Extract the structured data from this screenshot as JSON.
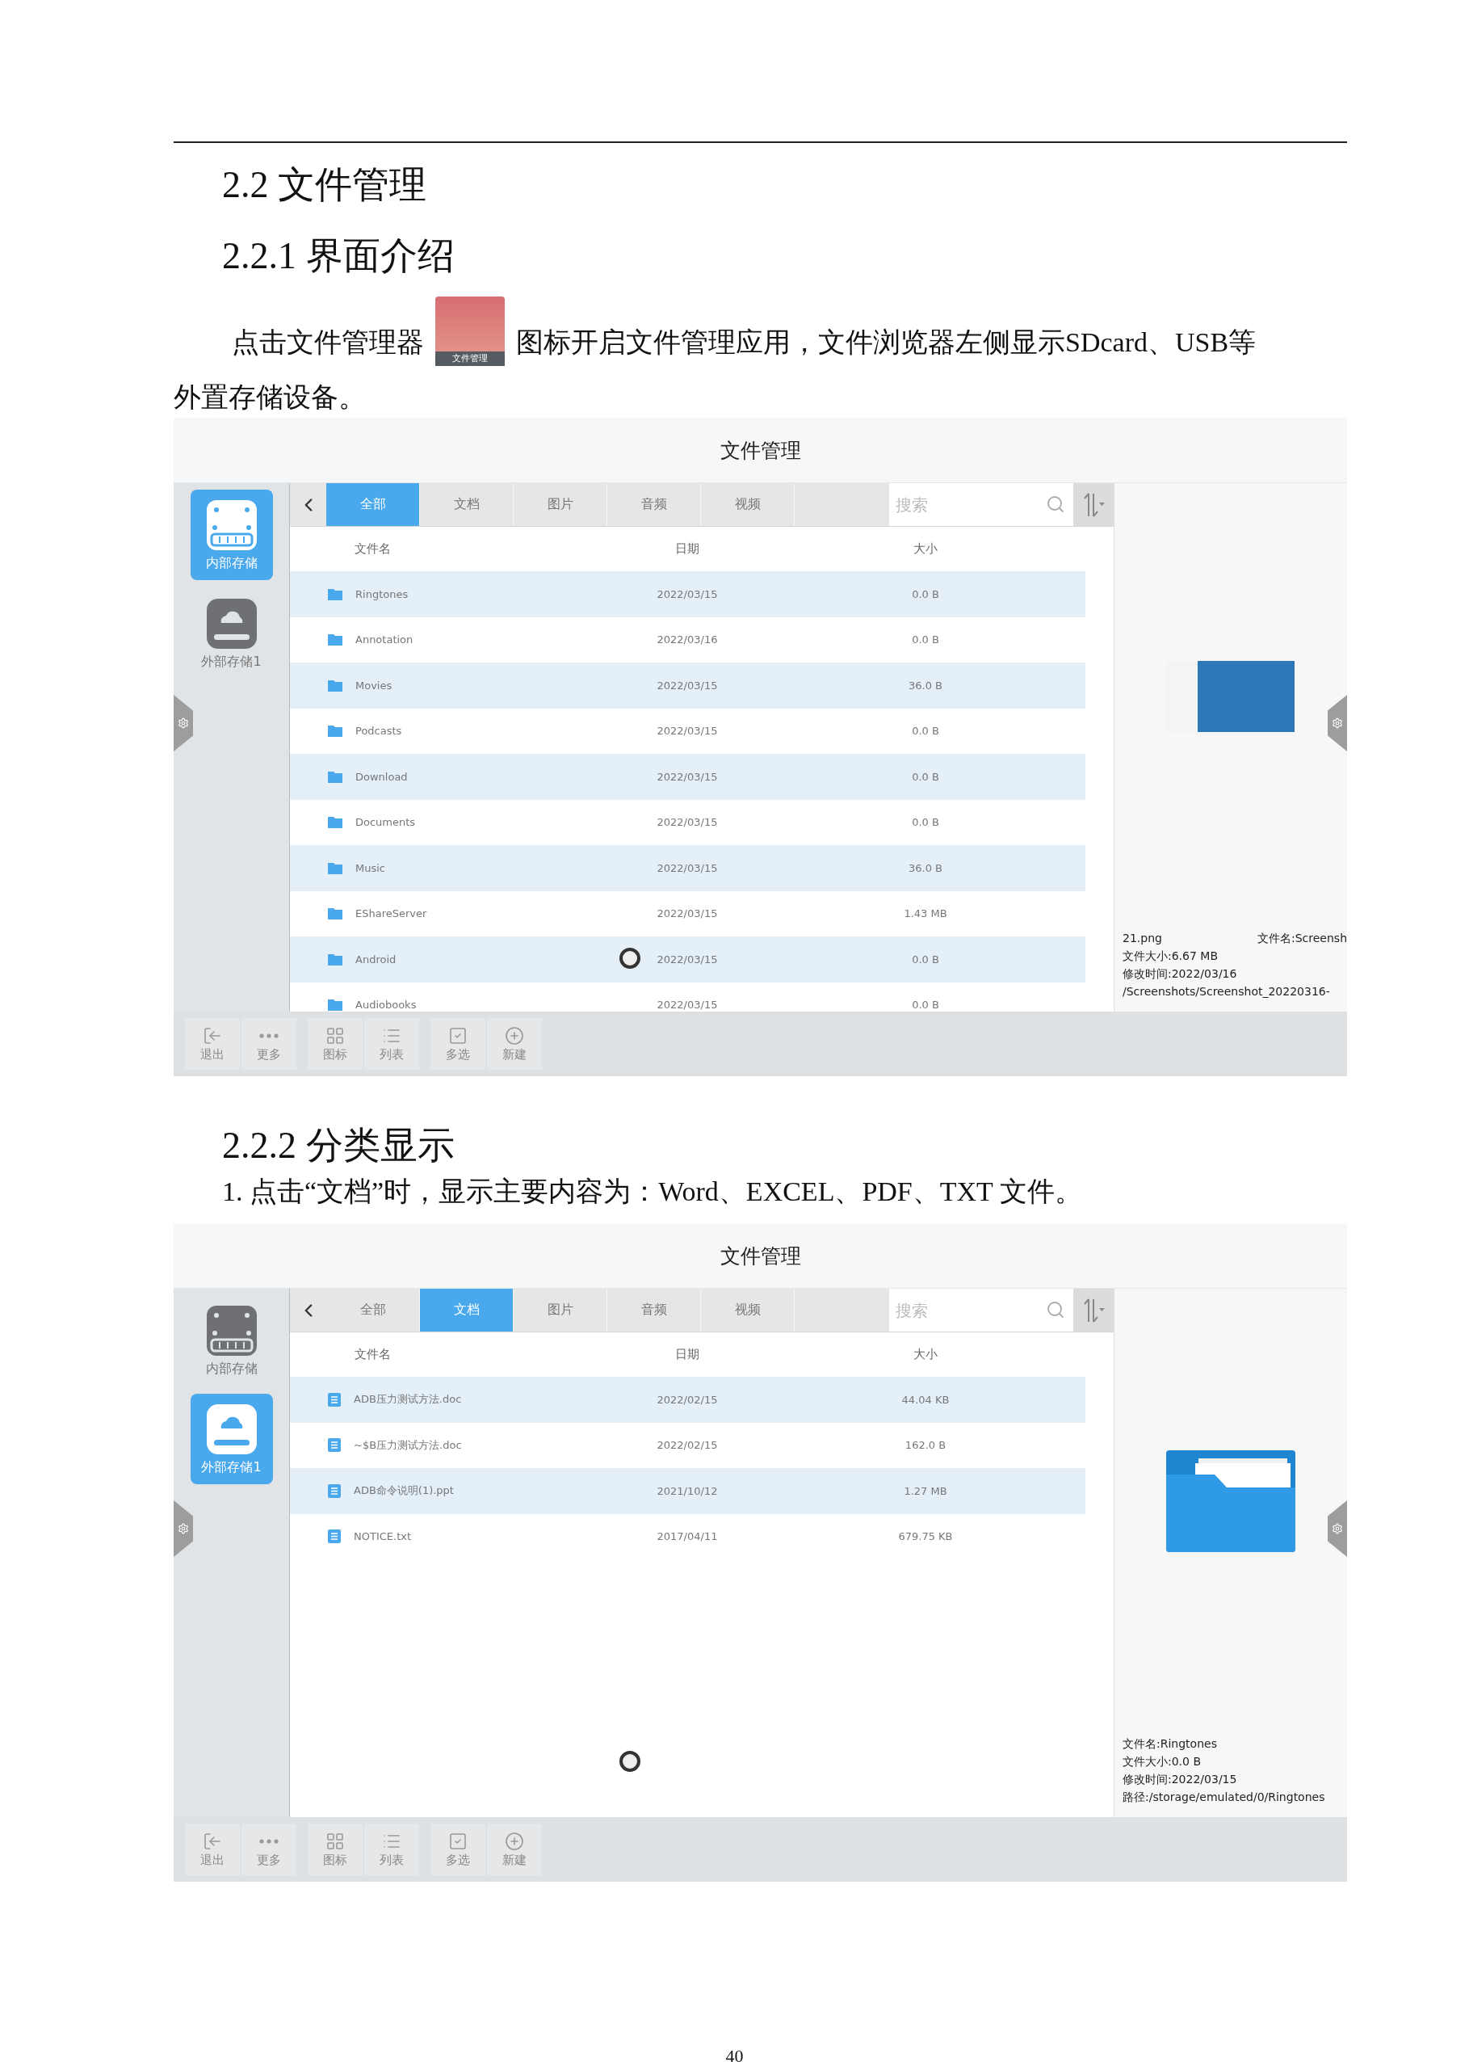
{
  "section_heading": "2.2 文件管理",
  "subsection_1": "2.2.1 界面介绍",
  "intro": {
    "before": "点击文件管理器",
    "icon_label": "文件管理",
    "after": "图标开启文件管理应用，文件浏览器左侧显示SDcard、USB等",
    "continuation": "外置存储设备。"
  },
  "screenshot_1": {
    "title": "文件管理",
    "storage": [
      {
        "label": "内部存储",
        "kind": "internal",
        "selected": true
      },
      {
        "label": "外部存储1",
        "kind": "external",
        "selected": false
      }
    ],
    "tabs": [
      {
        "label": "全部",
        "selected": true
      },
      {
        "label": "文档",
        "selected": false
      },
      {
        "label": "图片",
        "selected": false
      },
      {
        "label": "音频",
        "selected": false
      },
      {
        "label": "视频",
        "selected": false
      }
    ],
    "search": {
      "placeholder": "搜索"
    },
    "columns": [
      "文件名",
      "日期",
      "大小"
    ],
    "rows": [
      {
        "kind": "folder",
        "name": "Ringtones",
        "date": "2022/03/15",
        "size": "0.0 B"
      },
      {
        "kind": "folder",
        "name": "Annotation",
        "date": "2022/03/16",
        "size": "0.0 B"
      },
      {
        "kind": "folder",
        "name": "Movies",
        "date": "2022/03/15",
        "size": "36.0 B"
      },
      {
        "kind": "folder",
        "name": "Podcasts",
        "date": "2022/03/15",
        "size": "0.0 B"
      },
      {
        "kind": "folder",
        "name": "Download",
        "date": "2022/03/15",
        "size": "0.0 B"
      },
      {
        "kind": "folder",
        "name": "Documents",
        "date": "2022/03/15",
        "size": "0.0 B"
      },
      {
        "kind": "folder",
        "name": "Music",
        "date": "2022/03/15",
        "size": "36.0 B"
      },
      {
        "kind": "folder",
        "name": "EShareServer",
        "date": "2022/03/15",
        "size": "1.43 MB"
      },
      {
        "kind": "folder",
        "name": "Android",
        "date": "2022/03/15",
        "size": "0.0 B"
      },
      {
        "kind": "folder",
        "name": "Audiobooks",
        "date": "2022/03/15",
        "size": "0.0 B"
      }
    ],
    "preview": {
      "kind": "image",
      "lines": [
        [
          "21.png",
          "文件名:Screensh"
        ],
        [
          "文件大小:6.67 MB"
        ],
        [
          "修改时间:2022/03/16"
        ],
        [
          "/Screenshots/Screenshot_20220316-"
        ]
      ]
    },
    "toolbar": [
      [
        {
          "kind": "exit",
          "label": "退出"
        },
        {
          "kind": "more",
          "label": "更多"
        }
      ],
      [
        {
          "kind": "grid",
          "label": "图标"
        },
        {
          "kind": "list",
          "label": "列表"
        }
      ],
      [
        {
          "kind": "multi",
          "label": "多选"
        },
        {
          "kind": "new",
          "label": "新建"
        }
      ]
    ]
  },
  "subsection_2": "2.2.2  分类显示",
  "note": "1. 点击“文档”时，显示主要内容为：Word、EXCEL、PDF、TXT 文件。",
  "screenshot_2": {
    "title": "文件管理",
    "storage": [
      {
        "label": "内部存储",
        "kind": "internal",
        "selected": false
      },
      {
        "label": "外部存储1",
        "kind": "external",
        "selected": true
      }
    ],
    "tabs": [
      {
        "label": "全部",
        "selected": false
      },
      {
        "label": "文档",
        "selected": true
      },
      {
        "label": "图片",
        "selected": false
      },
      {
        "label": "音频",
        "selected": false
      },
      {
        "label": "视频",
        "selected": false
      }
    ],
    "search": {
      "placeholder": "搜索"
    },
    "columns": [
      "文件名",
      "日期",
      "大小"
    ],
    "rows": [
      {
        "kind": "doc",
        "name": "ADB压力测试方法.doc",
        "date": "2022/02/15",
        "size": "44.04 KB"
      },
      {
        "kind": "doc",
        "name": "~$B压力测试方法.doc",
        "date": "2022/02/15",
        "size": "162.0 B"
      },
      {
        "kind": "doc",
        "name": "ADB命令说明(1).ppt",
        "date": "2021/10/12",
        "size": "1.27 MB"
      },
      {
        "kind": "doc",
        "name": "NOTICE.txt",
        "date": "2017/04/11",
        "size": "679.75 KB"
      }
    ],
    "preview": {
      "kind": "folder",
      "lines": [
        [
          "文件名:Ringtones"
        ],
        [
          "文件大小:0.0 B"
        ],
        [
          "修改时间:2022/03/15"
        ],
        [
          "路径:/storage/emulated/0/Ringtones"
        ]
      ]
    },
    "toolbar": [
      [
        {
          "kind": "exit",
          "label": "退出"
        },
        {
          "kind": "more",
          "label": "更多"
        }
      ],
      [
        {
          "kind": "grid",
          "label": "图标"
        },
        {
          "kind": "list",
          "label": "列表"
        }
      ],
      [
        {
          "kind": "multi",
          "label": "多选"
        },
        {
          "kind": "new",
          "label": "新建"
        }
      ]
    ]
  },
  "page_number": "40"
}
